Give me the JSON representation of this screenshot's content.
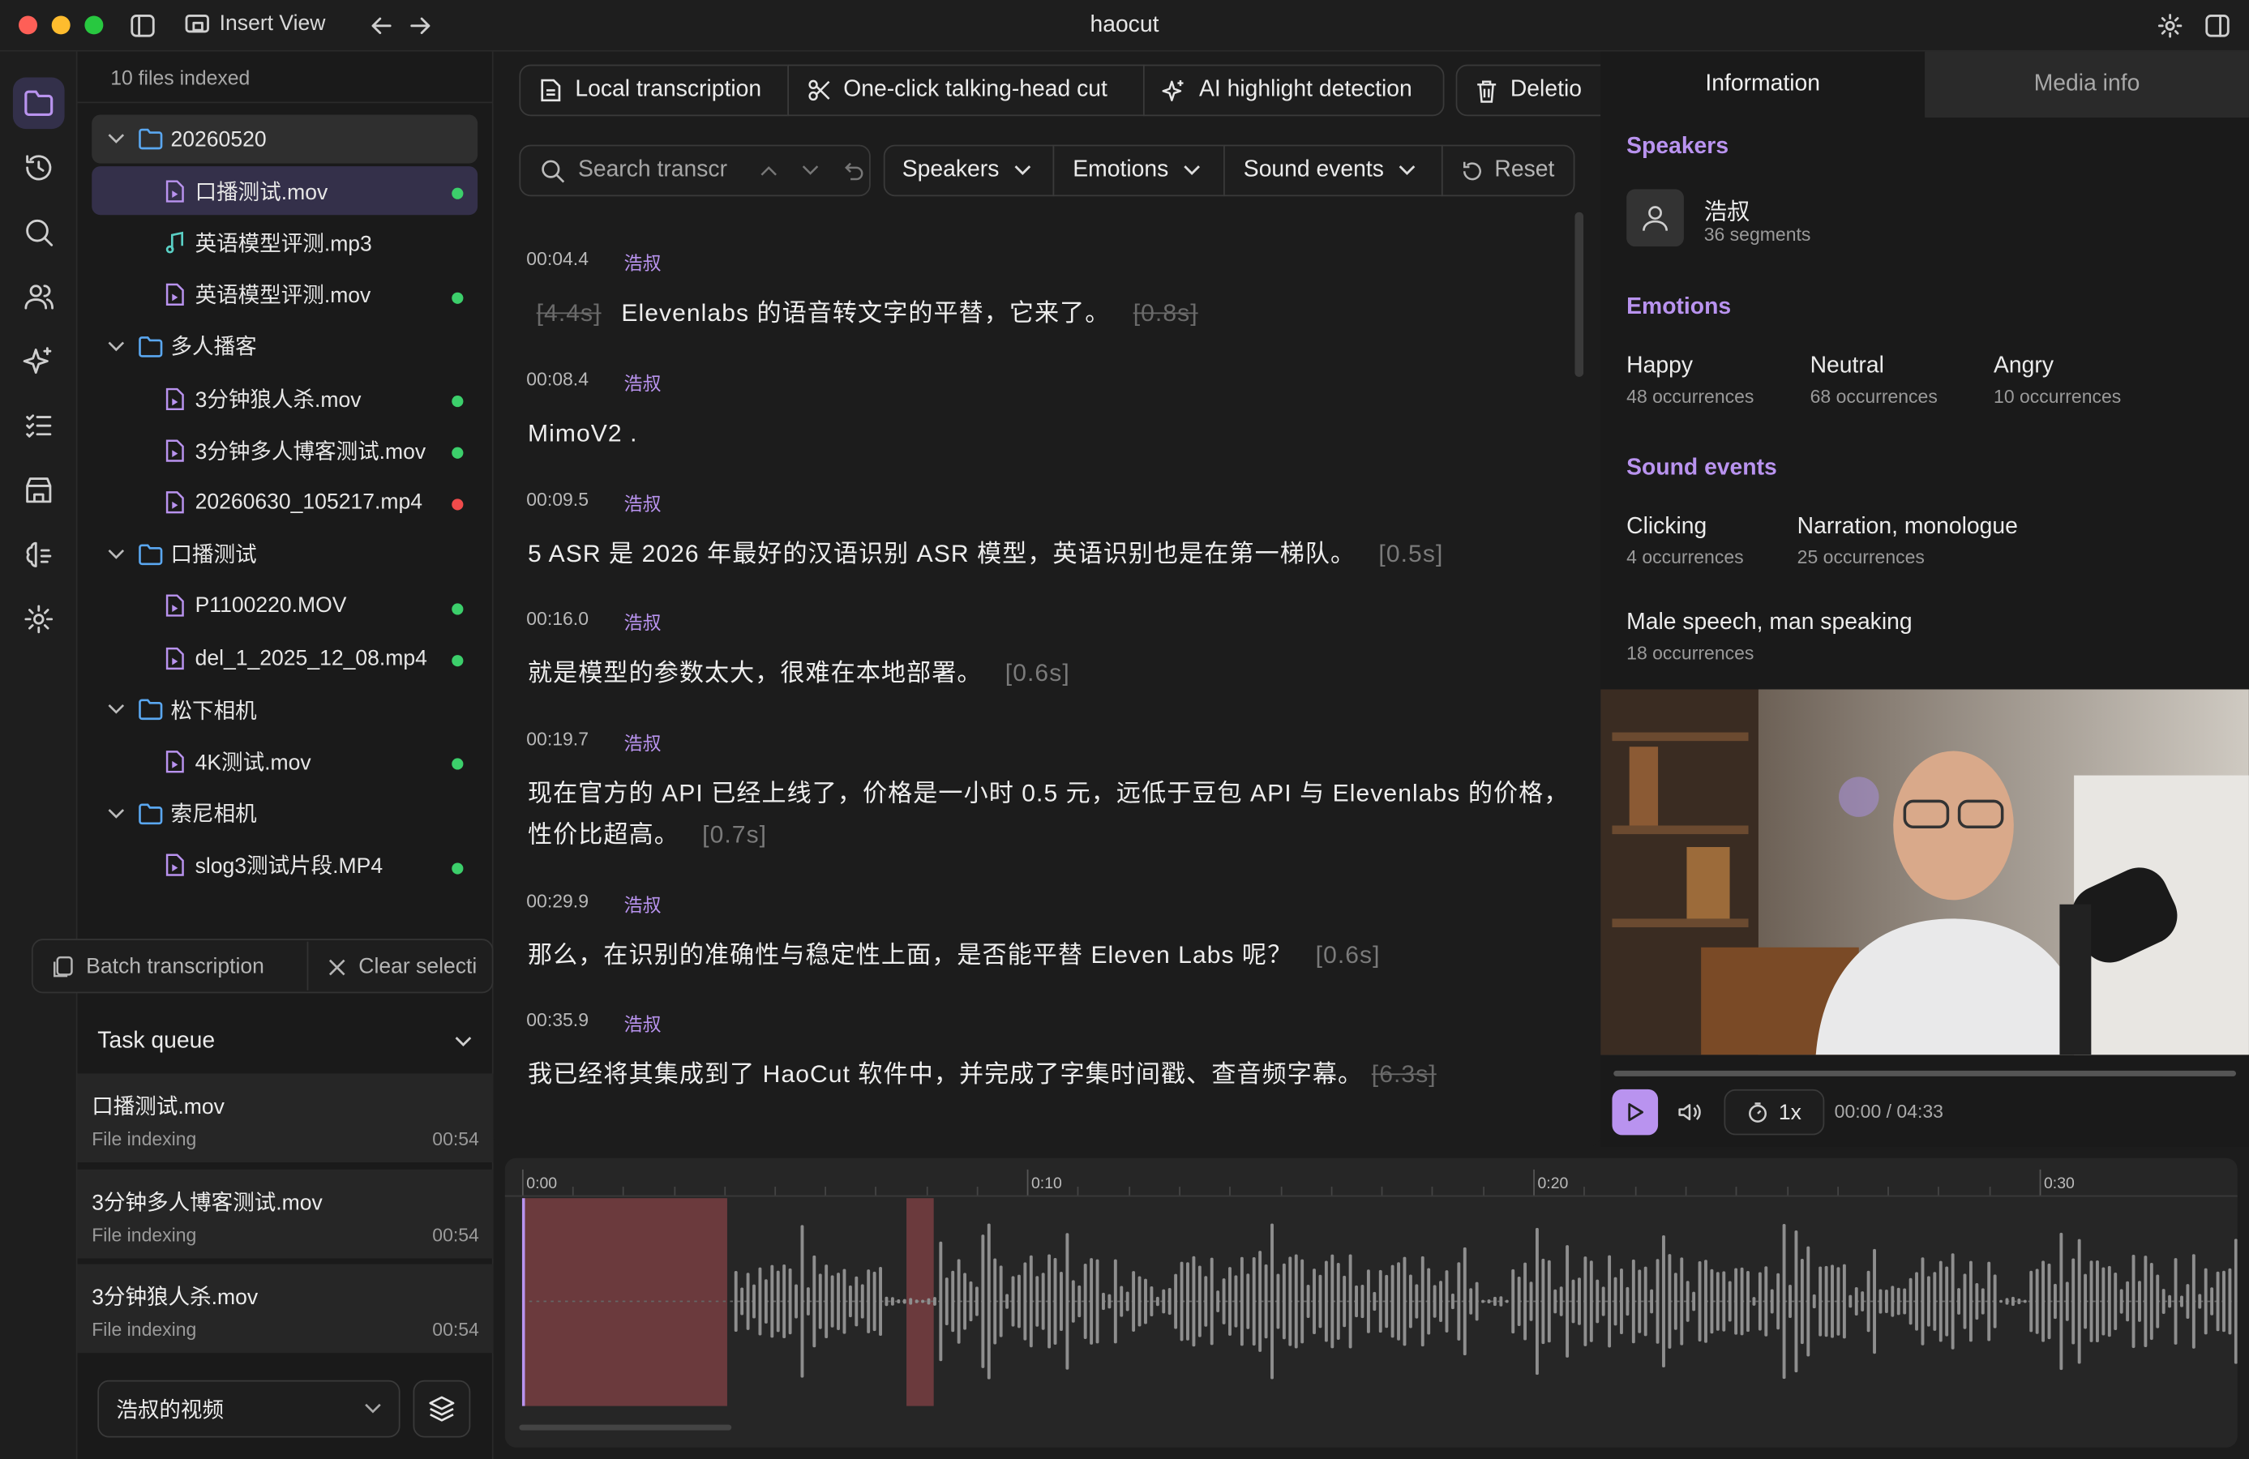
{
  "window": {
    "title": "haocut",
    "insert_view": "Insert View"
  },
  "sidebar_files": {
    "indexed_label": "10 files indexed",
    "tree": [
      {
        "type": "folder",
        "label": "20260520",
        "selected": true
      },
      {
        "type": "video",
        "label": "口播测试.mov",
        "status": "green",
        "active": true
      },
      {
        "type": "audio",
        "label": "英语模型评测.mp3",
        "status": ""
      },
      {
        "type": "video",
        "label": "英语模型评测.mov",
        "status": "green"
      },
      {
        "type": "folder",
        "label": "多人播客"
      },
      {
        "type": "video",
        "label": "3分钟狼人杀.mov",
        "status": "green"
      },
      {
        "type": "video",
        "label": "3分钟多人博客测试.mov",
        "status": "green"
      },
      {
        "type": "video",
        "label": "20260630_105217.mp4",
        "status": "red"
      },
      {
        "type": "folder",
        "label": "口播测试"
      },
      {
        "type": "video",
        "label": "P1100220.MOV",
        "status": "green"
      },
      {
        "type": "video",
        "label": "del_1_2025_12_08.mp4",
        "status": "green"
      },
      {
        "type": "folder",
        "label": "松下相机"
      },
      {
        "type": "video",
        "label": "4K测试.mov",
        "status": "green"
      },
      {
        "type": "folder",
        "label": "索尼相机"
      },
      {
        "type": "video",
        "label": "slog3测试片段.MP4",
        "status": "green"
      }
    ],
    "batch_label": "Batch transcription",
    "clear_label": "Clear selecti",
    "task_queue_label": "Task queue",
    "tasks": [
      {
        "name": "口播测试.mov",
        "status": "File indexing",
        "time": "00:54"
      },
      {
        "name": "3分钟多人博客测试.mov",
        "status": "File indexing",
        "time": "00:54"
      },
      {
        "name": "3分钟狼人杀.mov",
        "status": "File indexing",
        "time": "00:54"
      }
    ],
    "project_select": "浩叔的视频"
  },
  "toolbar": {
    "local_transcription": "Local transcription",
    "talking_head_cut": "One-click talking-head cut",
    "ai_highlight": "AI highlight detection",
    "deletion": "Deletio"
  },
  "filters": {
    "search_placeholder": "Search transcr",
    "speakers": "Speakers",
    "emotions": "Emotions",
    "sound_events": "Sound events",
    "reset": "Reset"
  },
  "transcript": [
    {
      "time": "00:04.4",
      "speaker": "浩叔",
      "pre": "[4.4s]",
      "text": "Elevenlabs 的语音转文字的平替，它来了。",
      "post": "[0.8s]",
      "post_strike": true
    },
    {
      "time": "00:08.4",
      "speaker": "浩叔",
      "pre": "",
      "text": "MimoV2 .",
      "post": ""
    },
    {
      "time": "00:09.5",
      "speaker": "浩叔",
      "pre": "",
      "text": "5 ASR 是 2026 年最好的汉语识别 ASR 模型，英语识别也是在第一梯队。",
      "post": "[0.5s]"
    },
    {
      "time": "00:16.0",
      "speaker": "浩叔",
      "pre": "",
      "text": "就是模型的参数太大，很难在本地部署。",
      "post": "[0.6s]"
    },
    {
      "time": "00:19.7",
      "speaker": "浩叔",
      "pre": "",
      "text": "现在官方的 API 已经上线了，价格是一小时 0.5 元，远低于豆包 API 与 Elevenlabs 的价格，性价比超高。",
      "post": "[0.7s]"
    },
    {
      "time": "00:29.9",
      "speaker": "浩叔",
      "pre": "",
      "text": "那么，在识别的准确性与稳定性上面，是否能平替 Eleven Labs 呢？",
      "post": "[0.6s]"
    },
    {
      "time": "00:35.9",
      "speaker": "浩叔",
      "pre": "",
      "text": "我已经将其集成到了 HaoCut 软件中，并完成了字集时间戳、查音频字幕。",
      "post": "[6.3s]",
      "post_strike": true
    }
  ],
  "info_panel": {
    "tab_information": "Information",
    "tab_media": "Media info",
    "speakers_title": "Speakers",
    "speaker": {
      "name": "浩叔",
      "segments": "36 segments"
    },
    "emotions_title": "Emotions",
    "emotions": [
      {
        "name": "Happy",
        "count": "48 occurrences"
      },
      {
        "name": "Neutral",
        "count": "68 occurrences"
      },
      {
        "name": "Angry",
        "count": "10 occurrences"
      }
    ],
    "sound_title": "Sound events",
    "sounds": [
      {
        "name": "Clicking",
        "count": "4 occurrences"
      },
      {
        "name": "Narration, monologue",
        "count": "25 occurrences"
      },
      {
        "name": "Male speech, man speaking",
        "count": "18 occurrences"
      }
    ]
  },
  "player": {
    "speed": "1x",
    "time": "00:00 / 04:33",
    "progress": 0
  },
  "timeline": {
    "ticks": [
      "0:00",
      "0:10",
      "0:20",
      "0:30"
    ],
    "accent_color": "#b993ef",
    "cut_color": "#6b3a3d"
  }
}
